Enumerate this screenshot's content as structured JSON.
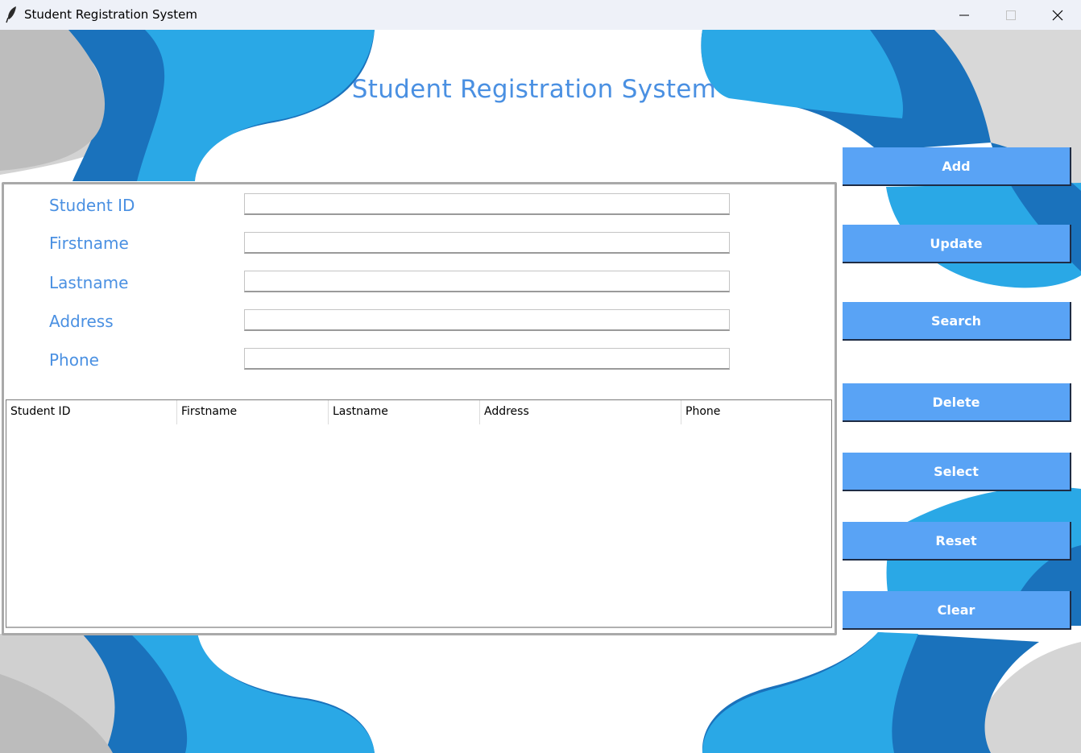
{
  "window": {
    "title": "Student Registration System",
    "controls": [
      "minimize-icon",
      "maximize-icon",
      "close-icon"
    ]
  },
  "app": {
    "heading": "Student Registration System"
  },
  "form": {
    "fields": [
      {
        "label": "Student ID",
        "value": ""
      },
      {
        "label": "Firstname",
        "value": ""
      },
      {
        "label": "Lastname",
        "value": ""
      },
      {
        "label": "Address",
        "value": ""
      },
      {
        "label": "Phone",
        "value": ""
      }
    ]
  },
  "table": {
    "columns": [
      "Student ID",
      "Firstname",
      "Lastname",
      "Address",
      "Phone"
    ],
    "rows": []
  },
  "buttons": {
    "add": "Add",
    "update": "Update",
    "search": "Search",
    "delete": "Delete",
    "select": "Select",
    "reset": "Reset",
    "clear": "Clear"
  },
  "colors": {
    "accent": "#4a90e2",
    "button_bg": "#59a3f5",
    "button_text": "#ffffff",
    "wave_dark_blue": "#1b73be",
    "wave_light_blue": "#2baae6",
    "wave_gray": "#c9c9c9"
  }
}
